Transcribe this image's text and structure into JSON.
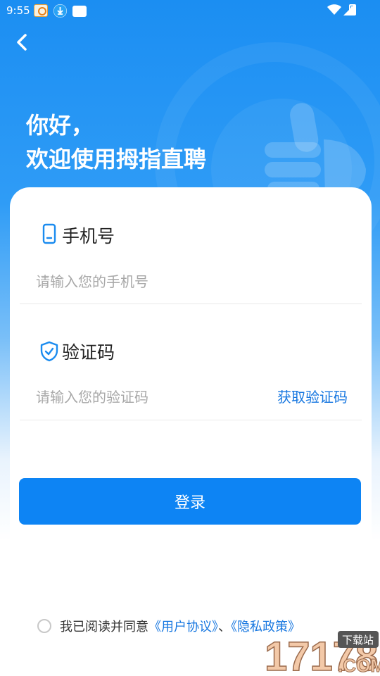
{
  "status_bar": {
    "time": "9:55"
  },
  "greeting": {
    "line1": "你好，",
    "line2": "欢迎使用拇指直聘"
  },
  "phone_field": {
    "title": "手机号",
    "placeholder": "请输入您的手机号"
  },
  "code_field": {
    "title": "验证码",
    "placeholder": "请输入您的验证码",
    "get_code_label": "获取验证码"
  },
  "login_button_label": "登录",
  "agreement": {
    "prefix": "我已阅读并同意",
    "user_agreement": "《用户协议》",
    "separator": "、",
    "privacy_policy": "《隐私政策》"
  },
  "watermark": {
    "number": "17178",
    "tag": "下载站",
    "domain": ".COM"
  },
  "colors": {
    "primary": "#0d84f4",
    "link": "#1777e0",
    "header_blue": "#1b8ef2"
  },
  "icons": [
    "back-icon",
    "phone-icon",
    "shield-check-icon",
    "thumbs-up-icon",
    "wifi-icon",
    "signal-icon",
    "battery-icon"
  ]
}
